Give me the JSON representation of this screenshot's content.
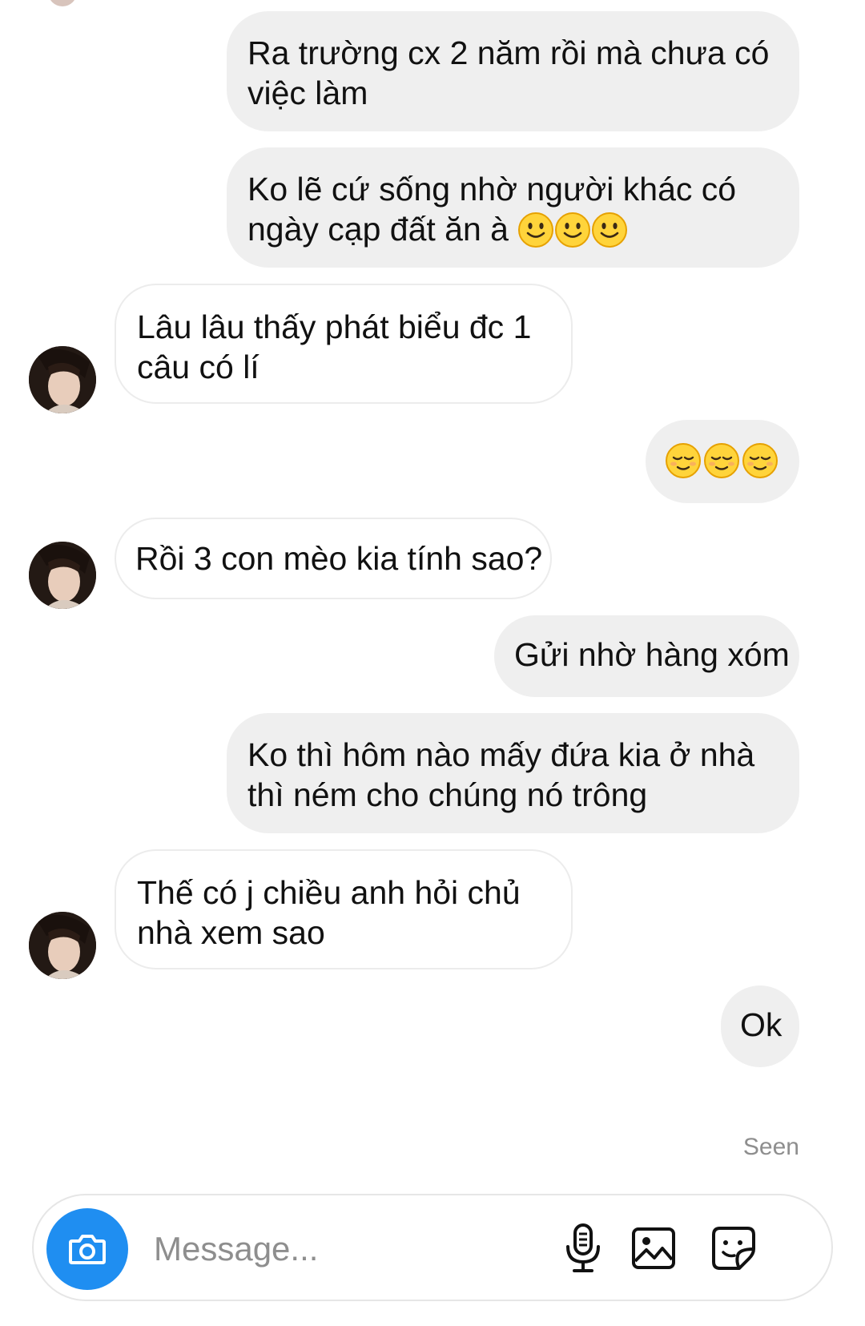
{
  "messages": [
    {
      "dir": "out",
      "lines": [
        "Ra trường cx 2 năm rồi mà chưa có",
        "việc làm"
      ]
    },
    {
      "dir": "out",
      "lines": [
        "Ko lẽ cứ sống nhờ người khác có",
        "ngày cạp đất ăn à"
      ],
      "emoji": "slightly-smiling-face ×3"
    },
    {
      "dir": "in",
      "lines": [
        "Lâu lâu thấy phát biểu đc 1",
        "câu có lí"
      ]
    },
    {
      "dir": "out",
      "emoji": "relieved-face ×3"
    },
    {
      "dir": "in",
      "lines": [
        "Rồi 3 con mèo kia tính sao?"
      ]
    },
    {
      "dir": "out",
      "lines": [
        "Gửi nhờ hàng xóm"
      ]
    },
    {
      "dir": "out",
      "lines": [
        "Ko thì hôm nào mấy đứa kia ở nhà",
        "thì ném cho chúng nó trông"
      ]
    },
    {
      "dir": "in",
      "lines": [
        "Thế có j chiều anh hỏi chủ",
        "nhà xem sao"
      ]
    },
    {
      "dir": "out",
      "lines": [
        "Ok"
      ]
    }
  ],
  "status": {
    "seen_label": "Seen"
  },
  "composer": {
    "placeholder": "Message...",
    "icons": [
      "camera-icon",
      "microphone-icon",
      "gallery-icon",
      "sticker-icon"
    ]
  },
  "colors": {
    "outgoing_bubble": "#efefef",
    "incoming_bubble": "#ffffff",
    "accent": "#1f8ef1",
    "muted_text": "#8e8e8e"
  }
}
